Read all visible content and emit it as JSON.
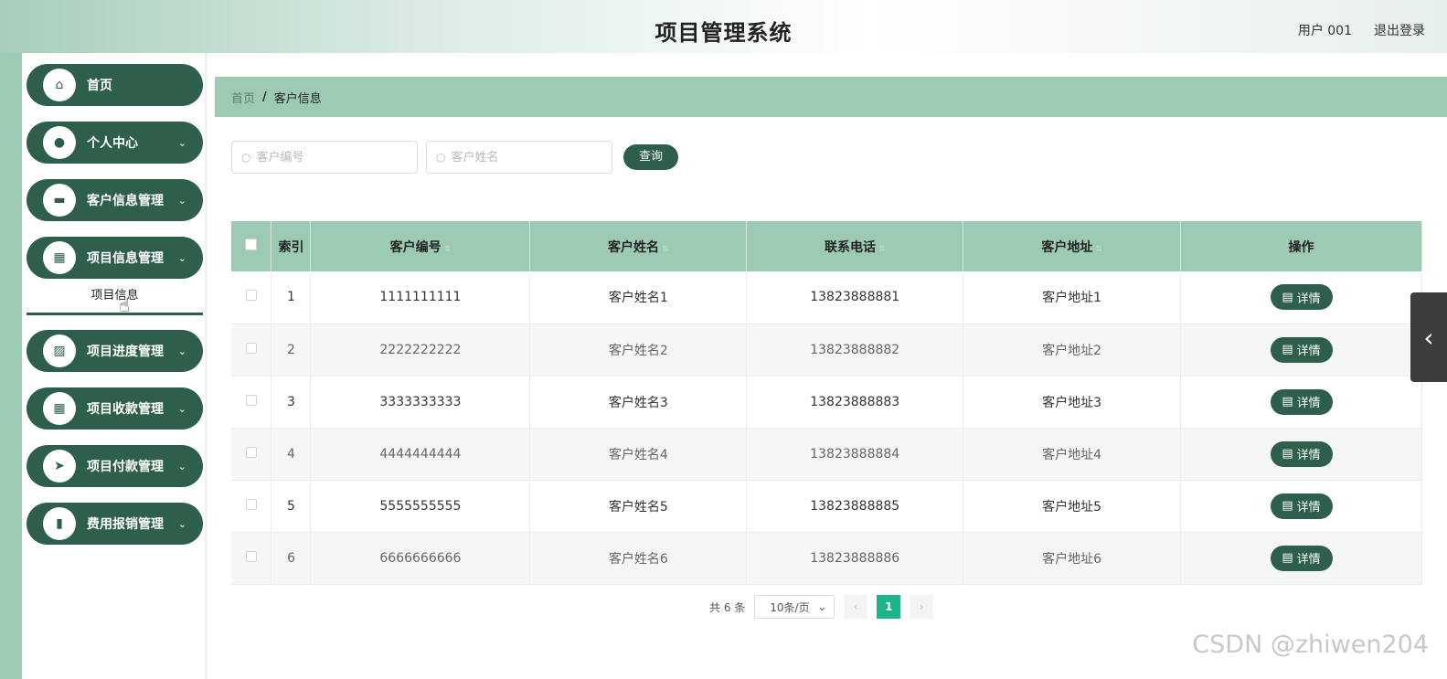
{
  "header": {
    "title": "项目管理系统",
    "user": "用户 001",
    "logout": "退出登录"
  },
  "sidebar": {
    "items": [
      {
        "label": "首页",
        "icon": "home-icon",
        "glyph": "⌂",
        "chevron": ""
      },
      {
        "label": "个人中心",
        "icon": "user-icon",
        "glyph": "●",
        "chevron": "⌄"
      },
      {
        "label": "客户信息管理",
        "icon": "monitor-icon",
        "glyph": "▬",
        "chevron": "⌄"
      },
      {
        "label": "项目信息管理",
        "icon": "grid-icon",
        "glyph": "▦",
        "chevron": "⌄"
      },
      {
        "label": "项目进度管理",
        "icon": "chart-icon",
        "glyph": "▨",
        "chevron": "⌄"
      },
      {
        "label": "项目收款管理",
        "icon": "grid-icon",
        "glyph": "▦",
        "chevron": "⌄"
      },
      {
        "label": "项目付款管理",
        "icon": "send-icon",
        "glyph": "➤",
        "chevron": "⌄"
      },
      {
        "label": "费用报销管理",
        "icon": "bar-chart-icon",
        "glyph": "▮",
        "chevron": "⌄"
      }
    ],
    "submenu": "项目信息"
  },
  "breadcrumb": {
    "home": "首页",
    "sep": "/",
    "current": "客户信息"
  },
  "search": {
    "customer_no_placeholder": "客户编号",
    "customer_name_placeholder": "客户姓名",
    "query_label": "查询"
  },
  "table": {
    "headers": [
      "索引",
      "客户编号",
      "客户姓名",
      "联系电话",
      "客户地址",
      "操作"
    ],
    "rows": [
      {
        "idx": "1",
        "no": "1111111111",
        "name": "客户姓名1",
        "phone": "13823888881",
        "addr": "客户地址1"
      },
      {
        "idx": "2",
        "no": "2222222222",
        "name": "客户姓名2",
        "phone": "13823888882",
        "addr": "客户地址2"
      },
      {
        "idx": "3",
        "no": "3333333333",
        "name": "客户姓名3",
        "phone": "13823888883",
        "addr": "客户地址3"
      },
      {
        "idx": "4",
        "no": "4444444444",
        "name": "客户姓名4",
        "phone": "13823888884",
        "addr": "客户地址4"
      },
      {
        "idx": "5",
        "no": "5555555555",
        "name": "客户姓名5",
        "phone": "13823888885",
        "addr": "客户地址5"
      },
      {
        "idx": "6",
        "no": "6666666666",
        "name": "客户姓名6",
        "phone": "13823888886",
        "addr": "客户地址6"
      }
    ],
    "detail_label": "详情"
  },
  "pagination": {
    "total": "共 6 条",
    "page_size": "10条/页",
    "current_page": "1",
    "prev": "‹",
    "next": "›"
  },
  "watermark": "CSDN @zhiwen204",
  "colors": {
    "primary": "#2d5f4a",
    "accent": "#9ccab3",
    "page_active": "#1fb38a"
  }
}
